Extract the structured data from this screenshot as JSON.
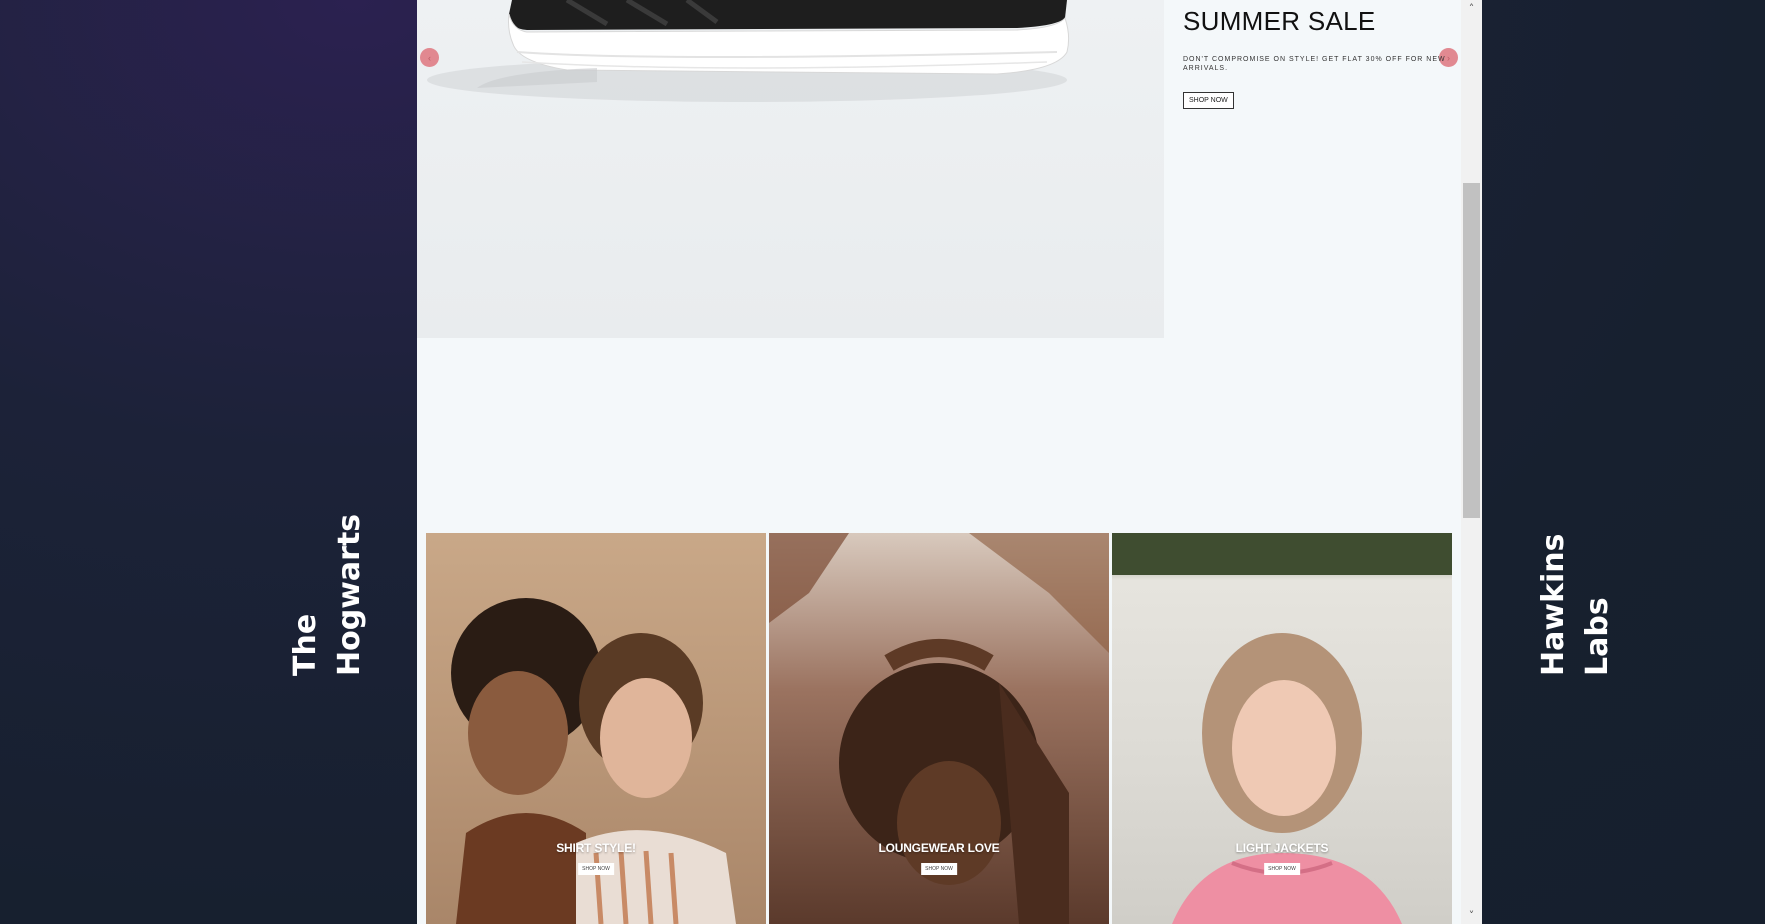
{
  "side_labels": {
    "left": [
      "The",
      "Hogwarts"
    ],
    "right": [
      "Hawkins",
      "Labs"
    ]
  },
  "hero": {
    "title": "SUMMER SALE",
    "description": "Don't compromise on style! Get flat 30% off for new arrivals.",
    "button_label": "SHOP NOW"
  },
  "categories": [
    {
      "title": "SHIRT STYLE!",
      "button_label": "SHOP NOW"
    },
    {
      "title": "LOUNGEWEAR LOVE",
      "button_label": "SHOP NOW"
    },
    {
      "title": "LIGHT JACKETS",
      "button_label": "SHOP NOW"
    }
  ],
  "scrollbar": {
    "up_icon": "chevron-up-icon",
    "down_icon": "chevron-down-icon"
  }
}
